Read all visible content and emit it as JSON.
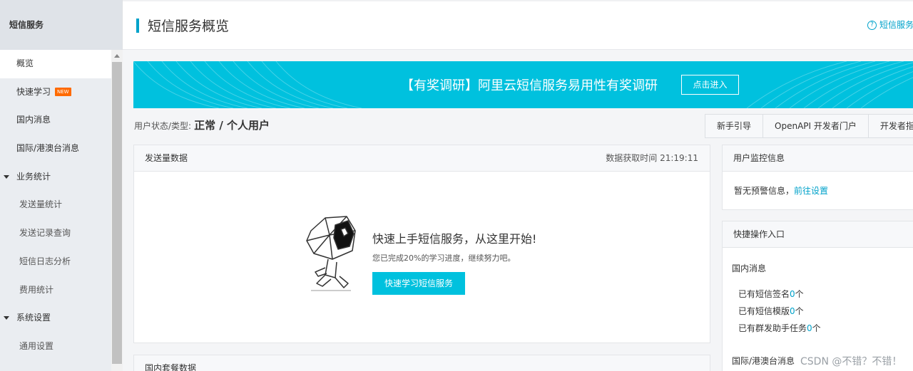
{
  "sidebar": {
    "title": "短信服务",
    "items": [
      {
        "label": "概览"
      },
      {
        "label": "快速学习",
        "badge": "NEW"
      },
      {
        "label": "国内消息"
      },
      {
        "label": "国际/港澳台消息"
      },
      {
        "label": "业务统计"
      },
      {
        "label": "发送量统计"
      },
      {
        "label": "发送记录查询"
      },
      {
        "label": "短信日志分析"
      },
      {
        "label": "费用统计"
      },
      {
        "label": "系统设置"
      },
      {
        "label": "通用设置"
      }
    ]
  },
  "header": {
    "title": "短信服务概览",
    "help_label": "短信服务",
    "help_icon": "?"
  },
  "banner": {
    "text": "【有奖调研】阿里云短信服务易用性有奖调研",
    "button": "点击进入"
  },
  "user_status": {
    "label": "用户状态/类型:",
    "value": "正常 / 个人用户"
  },
  "tabs": [
    "新手引导",
    "OpenAPI 开发者门户",
    "开发者指南"
  ],
  "send_panel": {
    "title": "发送量数据",
    "fetch_time": "数据获取时间 21:19:11",
    "promo_title": "快速上手短信服务，从这里开始!",
    "promo_sub": "您已完成20%的学习进度，继续努力吧。",
    "progress_percent": 20,
    "promo_button": "快速学习短信服务"
  },
  "package_panel": {
    "title": "国内套餐数据"
  },
  "monitor_panel": {
    "title": "用户监控信息",
    "text": "暂无预警信息，",
    "link": "前往设置"
  },
  "quick_panel": {
    "title": "快捷操作入口",
    "domestic_title": "国内消息",
    "lines": [
      {
        "prefix": "已有短信签名",
        "count": "0",
        "suffix": "个"
      },
      {
        "prefix": "已有短信模版",
        "count": "0",
        "suffix": "个"
      },
      {
        "prefix": "已有群发助手任务",
        "count": "0",
        "suffix": "个"
      }
    ],
    "intl_title": "国际/港澳台消息"
  },
  "watermark": "CSDN @不错？不错！",
  "colors": {
    "accent": "#00a2ca",
    "banner": "#00c1de",
    "brand_orange": "#ff6a00"
  }
}
